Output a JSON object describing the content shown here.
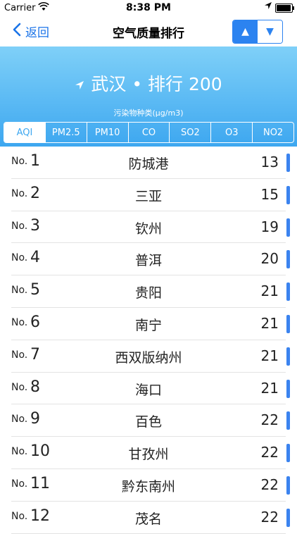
{
  "status_bar": {
    "carrier": "Carrier",
    "time": "8:38 PM",
    "wifi_icon": "wifi-icon",
    "location_icon": "location-arrow-icon",
    "battery_icon": "battery-icon"
  },
  "nav": {
    "back_label": "返回",
    "back_icon": "chevron-left-icon",
    "title": "空气质量排行",
    "sort_up_icon": "▲",
    "sort_down_icon": "▼"
  },
  "hero": {
    "location_icon": "➤",
    "city": "武汉",
    "separator": "•",
    "rank_label": "排行 200",
    "caption": "污染物种类(μg/m3)",
    "tabs": [
      {
        "label": "AQI",
        "active": true
      },
      {
        "label": "PM2.5",
        "active": false
      },
      {
        "label": "PM10",
        "active": false
      },
      {
        "label": "CO",
        "active": false
      },
      {
        "label": "SO2",
        "active": false
      },
      {
        "label": "O3",
        "active": false
      },
      {
        "label": "NO2",
        "active": false
      }
    ]
  },
  "colors": {
    "accent": "#2c83f0",
    "gradient_top": "#7fd0f8",
    "gradient_bottom": "#3da7f0",
    "bar": "#3b83ef"
  },
  "list": {
    "no_prefix": "No.",
    "rows": [
      {
        "rank": "1",
        "city": "防城港",
        "value": "13"
      },
      {
        "rank": "2",
        "city": "三亚",
        "value": "15"
      },
      {
        "rank": "3",
        "city": "钦州",
        "value": "19"
      },
      {
        "rank": "4",
        "city": "普洱",
        "value": "20"
      },
      {
        "rank": "5",
        "city": "贵阳",
        "value": "21"
      },
      {
        "rank": "6",
        "city": "南宁",
        "value": "21"
      },
      {
        "rank": "7",
        "city": "西双版纳州",
        "value": "21"
      },
      {
        "rank": "8",
        "city": "海口",
        "value": "21"
      },
      {
        "rank": "9",
        "city": "百色",
        "value": "22"
      },
      {
        "rank": "10",
        "city": "甘孜州",
        "value": "22"
      },
      {
        "rank": "11",
        "city": "黔东南州",
        "value": "22"
      },
      {
        "rank": "12",
        "city": "茂名",
        "value": "22"
      }
    ]
  }
}
